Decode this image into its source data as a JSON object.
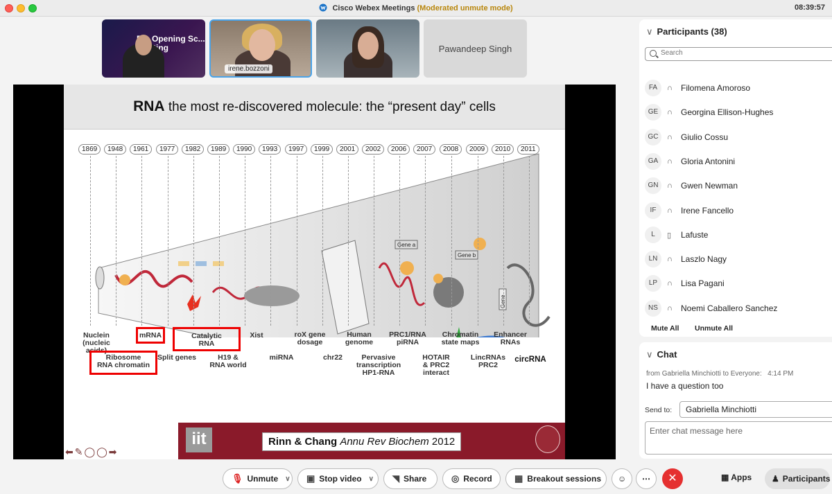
{
  "window": {
    "title": "Cisco Webex Meetings",
    "mode": "(Moderated unmute mode)",
    "clock": "08:39:57"
  },
  "videos": [
    {
      "name": "",
      "slide_text": "R... Opening Sc... meeting"
    },
    {
      "name": "irene.bozzoni"
    },
    {
      "name": ""
    },
    {
      "name": "Pawandeep Singh"
    }
  ],
  "slide": {
    "title_bold": "RNA",
    "title_rest": " the most re-discovered molecule: the “present day” cells",
    "years": [
      "1869",
      "1948",
      "1961",
      "1977",
      "1982",
      "1989",
      "1990",
      "1993",
      "1997",
      "1999",
      "2001",
      "2002",
      "2006",
      "2007",
      "2008",
      "2009",
      "2010",
      "2011"
    ],
    "top_labels": [
      "Nuclein\n(nucleic acids)",
      "mRNA",
      "Catalytic\nRNA",
      "Xist",
      "roX gene\ndosage",
      "Human\ngenome",
      "PRC1/RNA\npiRNA",
      "Chromatin\nstate maps",
      "Enhancer\nRNAs"
    ],
    "bottom_labels": [
      "Ribosome\nRNA chromatin",
      "Split genes",
      "H19 &\nRNA world",
      "miRNA",
      "chr22",
      "Pervasive\ntranscription\nHP1-RNA",
      "HOTAIR\n& PRC2\ninteract",
      "LincRNAs\nPRC2",
      "circRNA"
    ],
    "gene_a": "Gene a",
    "gene_b": "Gene b",
    "gene": "Gene",
    "iit": "iit",
    "citation_authors": "Rinn & Chang ",
    "citation_journal": "Annu Rev Biochem",
    "citation_year": " 2012"
  },
  "participants": {
    "header": "Participants (38)",
    "search_placeholder": "Search",
    "list": [
      {
        "initials": "FA",
        "name": "Filomena Amoroso",
        "device": "headset"
      },
      {
        "initials": "GE",
        "name": "Georgina Ellison-Hughes",
        "device": "headset"
      },
      {
        "initials": "GC",
        "name": "Giulio Cossu",
        "device": "headset"
      },
      {
        "initials": "GA",
        "name": "Gloria Antonini",
        "device": "headset"
      },
      {
        "initials": "GN",
        "name": "Gwen Newman",
        "device": "headset"
      },
      {
        "initials": "IF",
        "name": "Irene Fancello",
        "device": "headset"
      },
      {
        "initials": "L",
        "name": "Lafuste",
        "device": "phone"
      },
      {
        "initials": "LN",
        "name": "Laszlo Nagy",
        "device": "headset"
      },
      {
        "initials": "LP",
        "name": "Lisa Pagani",
        "device": "headset"
      },
      {
        "initials": "NS",
        "name": "Noemi Caballero Sanchez",
        "device": "headset"
      }
    ],
    "mute_all": "Mute All",
    "unmute_all": "Unmute All"
  },
  "chat": {
    "header": "Chat",
    "from": "from Gabriella Minchiotti to Everyone:",
    "time": "4:14 PM",
    "message": "I have a question too",
    "send_to_label": "Send to:",
    "send_to_value": "Gabriella Minchiotti",
    "input_placeholder": "Enter chat message here"
  },
  "controls": {
    "unmute": "Unmute",
    "stop_video": "Stop video",
    "share": "Share",
    "record": "Record",
    "breakout": "Breakout sessions",
    "apps": "Apps",
    "participants": "Participants"
  },
  "colors": {
    "accent_red": "#e53030",
    "slide_bar": "#8a1a2a",
    "label_box": "#ee0000",
    "mode_text": "#b8860b"
  }
}
